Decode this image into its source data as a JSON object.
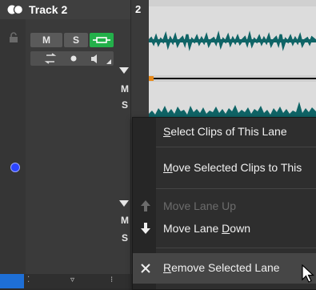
{
  "track": {
    "title": "Track 2",
    "number": "2",
    "mute_label": "M",
    "solo_label": "S",
    "lane_mute_label": "M",
    "lane_solo_label": "S"
  },
  "context_menu": {
    "items": [
      {
        "label": "Select Clips of This Lane",
        "mnemonic": "S",
        "enabled": true,
        "icon": ""
      },
      {
        "label": "Move Selected Clips to This",
        "mnemonic": "M",
        "enabled": true,
        "icon": ""
      },
      {
        "label": "Move Lane Up",
        "mnemonic": "",
        "enabled": false,
        "icon": "arrow-up-icon"
      },
      {
        "label": "Move Lane Down",
        "mnemonic": "D",
        "enabled": true,
        "icon": "arrow-down-icon"
      },
      {
        "label": "Remove Selected Lane",
        "mnemonic": "R",
        "enabled": true,
        "icon": "close-icon",
        "hover": true
      }
    ]
  },
  "colors": {
    "accent_green": "#23b04a",
    "waveform": "#0f6466",
    "record_blue": "#2b44ff",
    "marker_orange": "#e88a1a"
  }
}
